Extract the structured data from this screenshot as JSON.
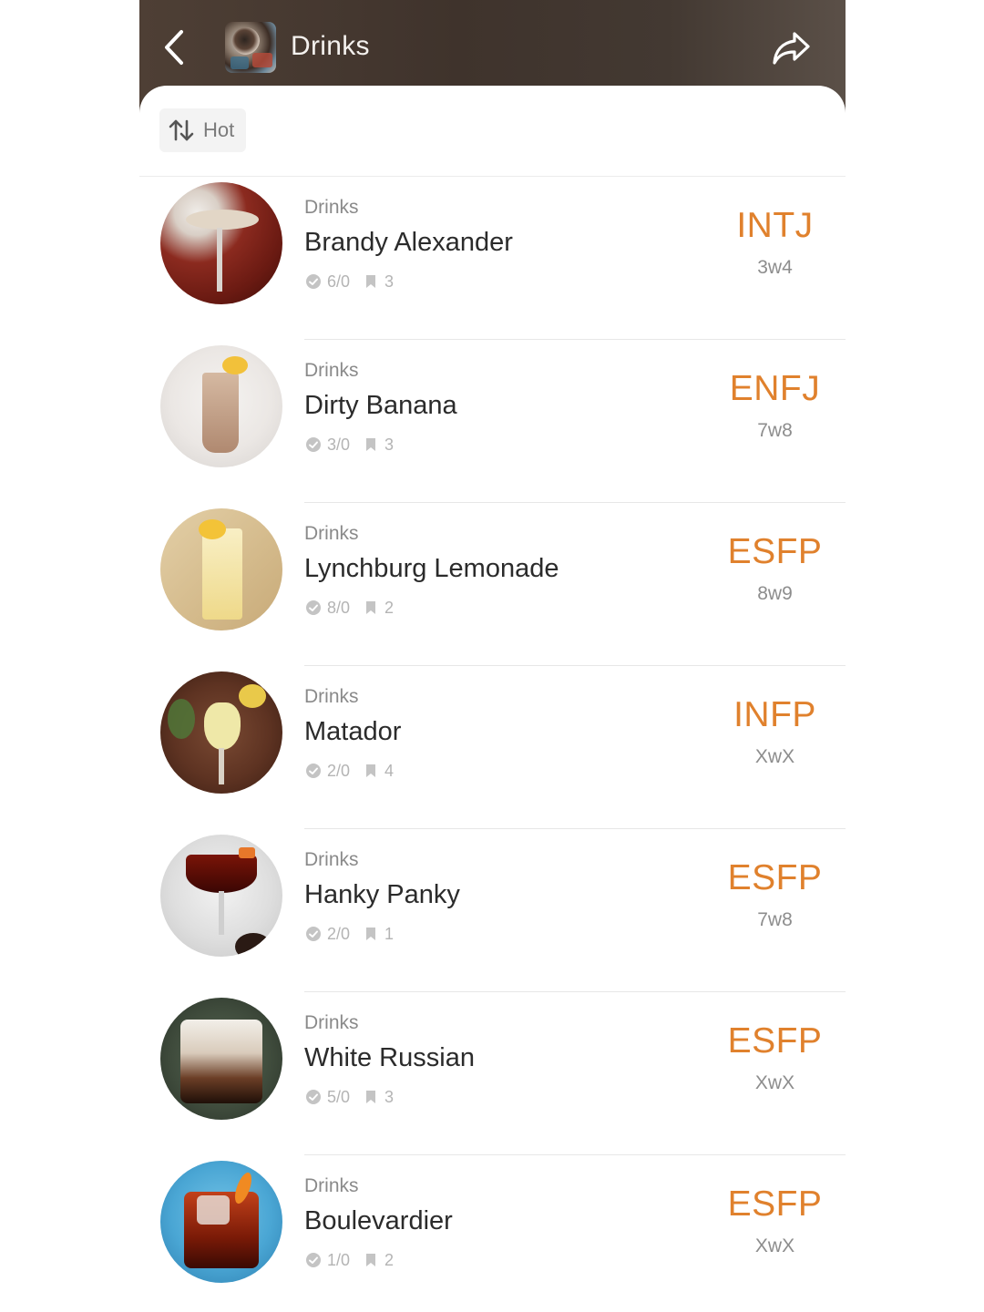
{
  "header": {
    "title": "Drinks",
    "bg_color": "#4a3d34"
  },
  "sort": {
    "label": "Hot"
  },
  "accent_color": "#e0812d",
  "items": [
    {
      "category": "Drinks",
      "name": "Brandy Alexander",
      "approvals": "6/0",
      "saves": "3",
      "mbti": "INTJ",
      "wing": "3w4"
    },
    {
      "category": "Drinks",
      "name": "Dirty Banana",
      "approvals": "3/0",
      "saves": "3",
      "mbti": "ENFJ",
      "wing": "7w8"
    },
    {
      "category": "Drinks",
      "name": "Lynchburg Lemonade",
      "approvals": "8/0",
      "saves": "2",
      "mbti": "ESFP",
      "wing": "8w9"
    },
    {
      "category": "Drinks",
      "name": "Matador",
      "approvals": "2/0",
      "saves": "4",
      "mbti": "INFP",
      "wing": "XwX"
    },
    {
      "category": "Drinks",
      "name": "Hanky Panky",
      "approvals": "2/0",
      "saves": "1",
      "mbti": "ESFP",
      "wing": "7w8"
    },
    {
      "category": "Drinks",
      "name": "White Russian",
      "approvals": "5/0",
      "saves": "3",
      "mbti": "ESFP",
      "wing": "XwX"
    },
    {
      "category": "Drinks",
      "name": "Boulevardier",
      "approvals": "1/0",
      "saves": "2",
      "mbti": "ESFP",
      "wing": "XwX"
    }
  ]
}
